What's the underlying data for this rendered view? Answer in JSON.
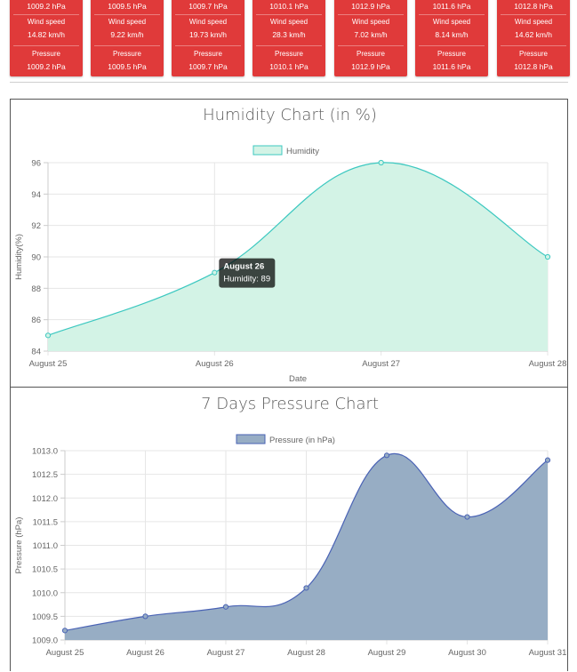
{
  "cards": [
    {
      "top_value": "1009.2 hPa",
      "wind_label": "Wind speed",
      "wind_value": "14.82 km/h",
      "pressure_label": "Pressure",
      "pressure_value": "1009.2 hPa"
    },
    {
      "top_value": "1009.5 hPa",
      "wind_label": "Wind speed",
      "wind_value": "9.22 km/h",
      "pressure_label": "Pressure",
      "pressure_value": "1009.5 hPa"
    },
    {
      "top_value": "1009.7 hPa",
      "wind_label": "Wind speed",
      "wind_value": "19.73 km/h",
      "pressure_label": "Pressure",
      "pressure_value": "1009.7 hPa"
    },
    {
      "top_value": "1010.1 hPa",
      "wind_label": "Wind speed",
      "wind_value": "28.3 km/h",
      "pressure_label": "Pressure",
      "pressure_value": "1010.1 hPa"
    },
    {
      "top_value": "1012.9 hPa",
      "wind_label": "Wind speed",
      "wind_value": "7.02 km/h",
      "pressure_label": "Pressure",
      "pressure_value": "1012.9 hPa"
    },
    {
      "top_value": "1011.6 hPa",
      "wind_label": "Wind speed",
      "wind_value": "8.14 km/h",
      "pressure_label": "Pressure",
      "pressure_value": "1011.6 hPa"
    },
    {
      "top_value": "1012.8 hPa",
      "wind_label": "Wind speed",
      "wind_value": "14.62 km/h",
      "pressure_label": "Pressure",
      "pressure_value": "1012.8 hPa"
    }
  ],
  "colors": {
    "card_bg": "#e03a3a",
    "humidity_line": "#3cc8c0",
    "humidity_fill": "#d3f3e6",
    "pressure_line": "#4a63b5",
    "pressure_fill": "#97adc4",
    "grid": "#e6e6e6"
  },
  "chart_data": [
    {
      "type": "area",
      "title": "Humidity Chart (in %)",
      "xlabel": "Date",
      "ylabel": "Humidity(%)",
      "categories": [
        "August 25",
        "August 26",
        "August 27",
        "August 28"
      ],
      "series": [
        {
          "name": "Humidity",
          "values": [
            85,
            89,
            96,
            90
          ]
        }
      ],
      "ylim": [
        84,
        96
      ],
      "yticks": [
        "84",
        "86",
        "88",
        "90",
        "92",
        "94",
        "96"
      ],
      "grid": true,
      "legend": "top",
      "tooltip": {
        "title": "August 26",
        "body": "Humidity: 89",
        "index": 1
      }
    },
    {
      "type": "area",
      "title": "7 Days Pressure Chart",
      "xlabel": "",
      "ylabel": "Pressure (hPa)",
      "categories": [
        "August 25",
        "August 26",
        "August 27",
        "August 28",
        "August 29",
        "August 30",
        "August 31"
      ],
      "series": [
        {
          "name": "Pressure (in hPa)",
          "values": [
            1009.2,
            1009.5,
            1009.7,
            1010.1,
            1012.9,
            1011.6,
            1012.8
          ]
        }
      ],
      "ylim": [
        1009.0,
        1013.0
      ],
      "yticks": [
        "1009.0",
        "1009.5",
        "1010.0",
        "1010.5",
        "1011.0",
        "1011.5",
        "1012.0",
        "1012.5",
        "1013.0"
      ],
      "grid": true,
      "legend": "top"
    }
  ]
}
